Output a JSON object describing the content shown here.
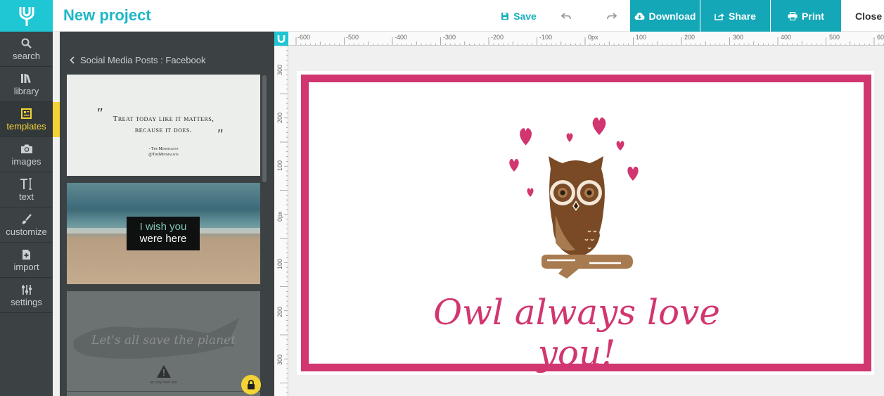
{
  "app": {
    "project_title": "New project",
    "logo_icon": "logo-icon"
  },
  "toolbar": {
    "save_label": "Save",
    "download_label": "Download",
    "share_label": "Share",
    "print_label": "Print",
    "close_label": "Close"
  },
  "leftnav": {
    "items": [
      {
        "label": "search",
        "icon": "search-icon"
      },
      {
        "label": "library",
        "icon": "library-icon"
      },
      {
        "label": "templates",
        "icon": "templates-icon"
      },
      {
        "label": "images",
        "icon": "camera-icon"
      },
      {
        "label": "text",
        "icon": "text-icon"
      },
      {
        "label": "customize",
        "icon": "brush-icon"
      },
      {
        "label": "import",
        "icon": "import-icon"
      },
      {
        "label": "settings",
        "icon": "sliders-icon"
      }
    ],
    "active": "templates"
  },
  "panel": {
    "breadcrumb": "Social Media Posts : Facebook",
    "templates": [
      {
        "line1": "Treat today like it matters,",
        "line2": "because it does.",
        "author": "- The Minimalists",
        "handle": "@TheMinimalists"
      },
      {
        "line1": "I wish you",
        "line2": "were here"
      },
      {
        "line1": "Let's all save the planet",
        "line2": "we only have one"
      }
    ]
  },
  "ruler": {
    "h_ticks": [
      "-600",
      "-500",
      "-400",
      "-300",
      "-200",
      "-100",
      "0px",
      "100",
      "200",
      "300",
      "400",
      "500",
      "60"
    ],
    "v_ticks": [
      "300",
      "200",
      "100",
      "0px",
      "100",
      "200",
      "300"
    ]
  },
  "canvas": {
    "card_text": "Owl always love you!"
  },
  "colors": {
    "accent": "#1fc6d4",
    "accent_dark": "#14a7b7",
    "highlight": "#f3d335",
    "sidebar": "#3c4144",
    "pink": "#d13670",
    "owl_brown": "#7a4a26",
    "owl_light": "#a77a4f"
  }
}
